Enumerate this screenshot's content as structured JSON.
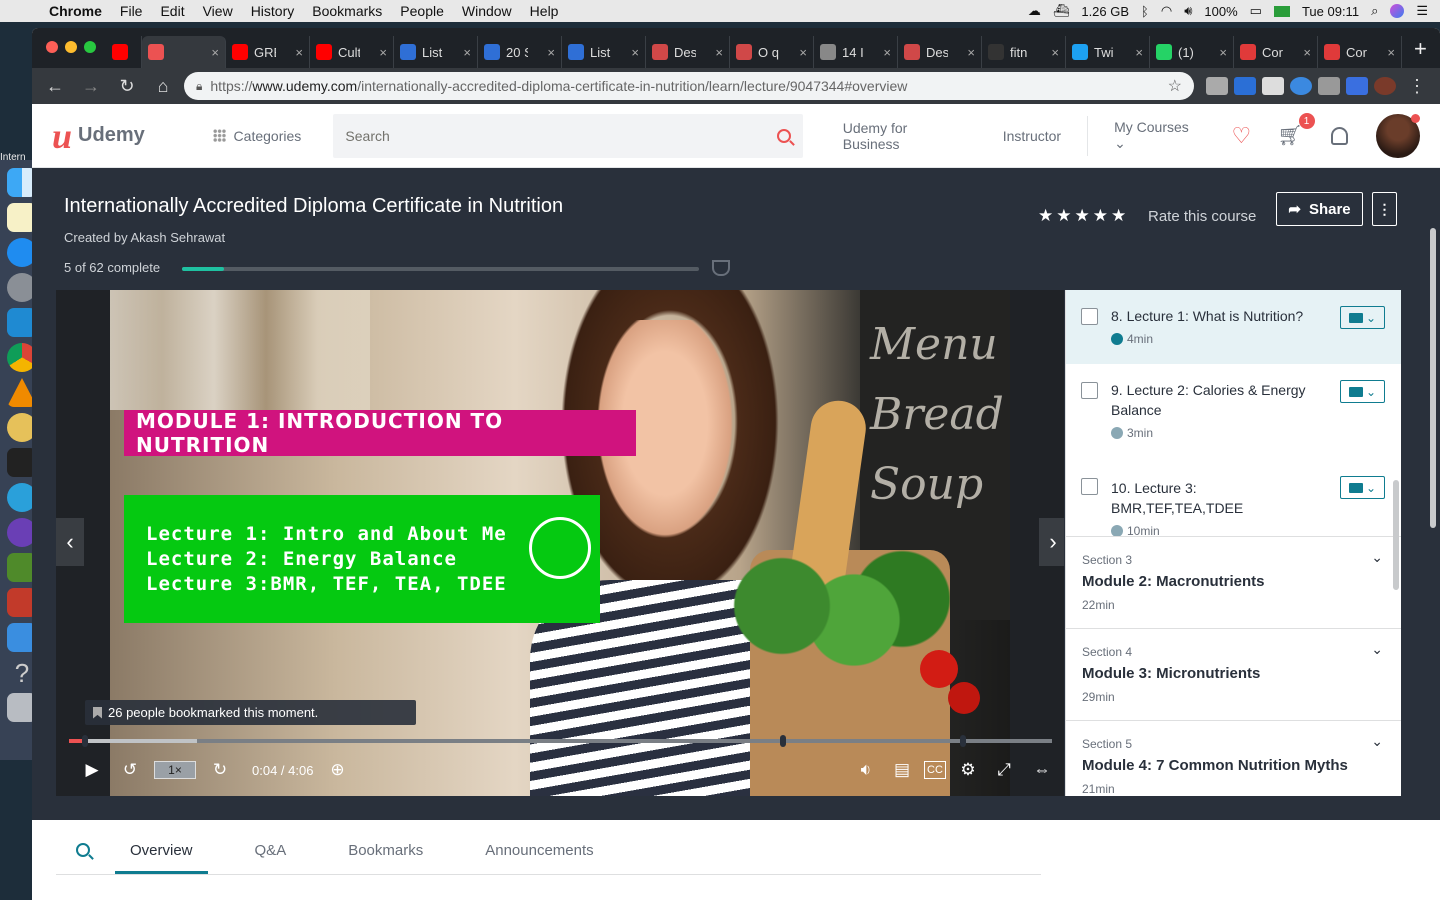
{
  "menubar": {
    "app": "Chrome",
    "menus": [
      "File",
      "Edit",
      "View",
      "History",
      "Bookmarks",
      "People",
      "Window",
      "Help"
    ],
    "memory": "1.26 GB",
    "battery": "100%",
    "clock": "Tue 09:11"
  },
  "desktop_label": "Intern",
  "browser": {
    "tabs": [
      {
        "label": "",
        "favicon_color": "#ff0000",
        "icon": "youtube-icon"
      },
      {
        "label": "",
        "favicon_color": "#ec5252",
        "icon": "udemy-icon",
        "active": true
      },
      {
        "label": "GRE",
        "favicon_color": "#ff0000",
        "icon": "youtube-icon"
      },
      {
        "label": "Cult",
        "favicon_color": "#ff0000",
        "icon": "youtube-icon"
      },
      {
        "label": "List",
        "favicon_color": "#2f6fd6",
        "icon": "globe-icon"
      },
      {
        "label": "20 S",
        "favicon_color": "#2f6fd6",
        "icon": "globe-icon"
      },
      {
        "label": "List",
        "favicon_color": "#2f6fd6",
        "icon": "globe-icon"
      },
      {
        "label": "Des",
        "favicon_color": "#d04848",
        "icon": "dumbbell-icon"
      },
      {
        "label": "O q",
        "favicon_color": "#d04848",
        "icon": "dumbbell-icon"
      },
      {
        "label": "14 I",
        "favicon_color": "#888888",
        "icon": "image-icon"
      },
      {
        "label": "Des",
        "favicon_color": "#d04848",
        "icon": "dumbbell-icon"
      },
      {
        "label": "fitn",
        "favicon_color": "#333333",
        "icon": "github-icon"
      },
      {
        "label": "Twi",
        "favicon_color": "#1da1f2",
        "icon": "twitter-icon"
      },
      {
        "label": "(1)",
        "favicon_color": "#25d366",
        "icon": "whatsapp-icon"
      },
      {
        "label": "Cor",
        "favicon_color": "#e03a3a",
        "icon": "c-icon"
      },
      {
        "label": "Cor",
        "favicon_color": "#e03a3a",
        "icon": "c-icon"
      }
    ],
    "url_scheme": "https://",
    "url_host": "www.udemy.com",
    "url_path": "/internationally-accredited-diploma-certificate-in-nutrition/learn/lecture/9047344#overview"
  },
  "header": {
    "logo_text": "Udemy",
    "categories": "Categories",
    "search_placeholder": "Search",
    "udemy_for_business": "Udemy for Business",
    "instructor": "Instructor",
    "my_courses": "My Courses",
    "cart_badge": "1"
  },
  "course": {
    "title": "Internationally Accredited Diploma Certificate in Nutrition",
    "created_by": "Created by Akash Sehrawat",
    "progress_text": "5 of 62 complete",
    "progress_fraction": 0.0806,
    "rating_stars": "★★★★★",
    "rate_label": "Rate this course",
    "share_label": "Share",
    "more_label": "⋮"
  },
  "video": {
    "module_banner": "MODULE 1: INTRODUCTION TO NUTRITION",
    "lecture_lines": [
      "Lecture 1: Intro and About Me",
      "Lecture 2: Energy Balance",
      "Lecture 3:BMR, TEF, TEA, TDEE"
    ],
    "board_text": "Menu Bread Soup",
    "bookmark_note": "26 people bookmarked this moment.",
    "speed": "1×",
    "time": "0:04 / 4:06",
    "played_fraction": 0.016
  },
  "sidebar": {
    "lectures": [
      {
        "title": "8. Lecture 1: What is Nutrition?",
        "duration": "4min",
        "current": true
      },
      {
        "title": "9. Lecture 2: Calories & Energy Balance",
        "duration": "3min",
        "current": false
      },
      {
        "title": "10. Lecture 3: BMR,TEF,TEA,TDEE",
        "duration": "10min",
        "current": false
      }
    ],
    "sections": [
      {
        "number": "Section 3",
        "title": "Module 2: Macronutrients",
        "duration": "22min"
      },
      {
        "number": "Section 4",
        "title": "Module 3: Micronutrients",
        "duration": "29min"
      },
      {
        "number": "Section 5",
        "title": "Module 4: 7 Common Nutrition Myths",
        "duration": "21min"
      }
    ]
  },
  "bottom_tabs": [
    "Overview",
    "Q&A",
    "Bookmarks",
    "Announcements"
  ],
  "colors": {
    "udemy_red": "#ec5252",
    "teal": "#0f7c90",
    "progress_green": "#1fc1a1",
    "banner_magenta": "#d0137e",
    "lecture_green": "#05c911",
    "dark_header": "#29303b"
  }
}
